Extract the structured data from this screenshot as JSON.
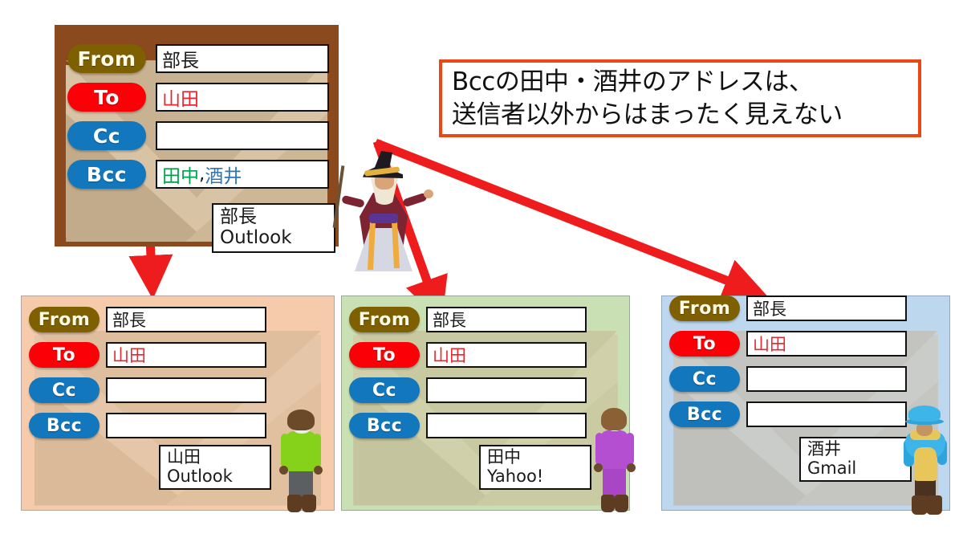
{
  "title": "Bcc explanation diagram",
  "fields": {
    "from_label": "From",
    "to_label": "To",
    "cc_label": "Cc",
    "bcc_label": "Bcc"
  },
  "sender_panel": {
    "name": "sender-envelope",
    "from_value": "部長",
    "to_value": "山田",
    "cc_value": "",
    "bcc_value_1": "田中",
    "bcc_separator": ",",
    "bcc_value_2": "酒井",
    "tag_line1": "部長",
    "tag_line2": "Outlook"
  },
  "callout": {
    "line1": "Bccの田中・酒井のアドレスは、",
    "line2": "送信者以外からはまったく見えない",
    "border_color": "#EA4715"
  },
  "recipients": [
    {
      "name": "yamada",
      "bg_color": "#F6CBAC",
      "from_value": "部長",
      "to_value": "山田",
      "cc_value": "",
      "bcc_value": "",
      "tag_line1": "山田",
      "tag_line2": "Outlook"
    },
    {
      "name": "tanaka",
      "bg_color": "#C8E0B3",
      "from_value": "部長",
      "to_value": "山田",
      "cc_value": "",
      "bcc_value": "",
      "tag_line1": "田中",
      "tag_line2": "Yahoo!"
    },
    {
      "name": "sakai",
      "bg_color": "#BDD7EE",
      "from_value": "部長",
      "to_value": "山田",
      "cc_value": "",
      "bcc_value": "",
      "tag_line1": "酒井",
      "tag_line2": "Gmail"
    }
  ],
  "colors": {
    "from_pill": "#7F6000",
    "to_pill": "#FB0007",
    "cc_pill": "#1277BD",
    "bcc_pill": "#1277BD",
    "envelope_bg": "#8A4A1E",
    "arrow": "#EE1C1C",
    "to_text": "#E8262D",
    "bcc_tanaka_text": "#00A14B",
    "bcc_sakai_text": "#2E75B6"
  },
  "arrows": [
    {
      "name": "arrow-to-yamada"
    },
    {
      "name": "arrow-to-tanaka"
    },
    {
      "name": "arrow-to-sakai"
    }
  ]
}
